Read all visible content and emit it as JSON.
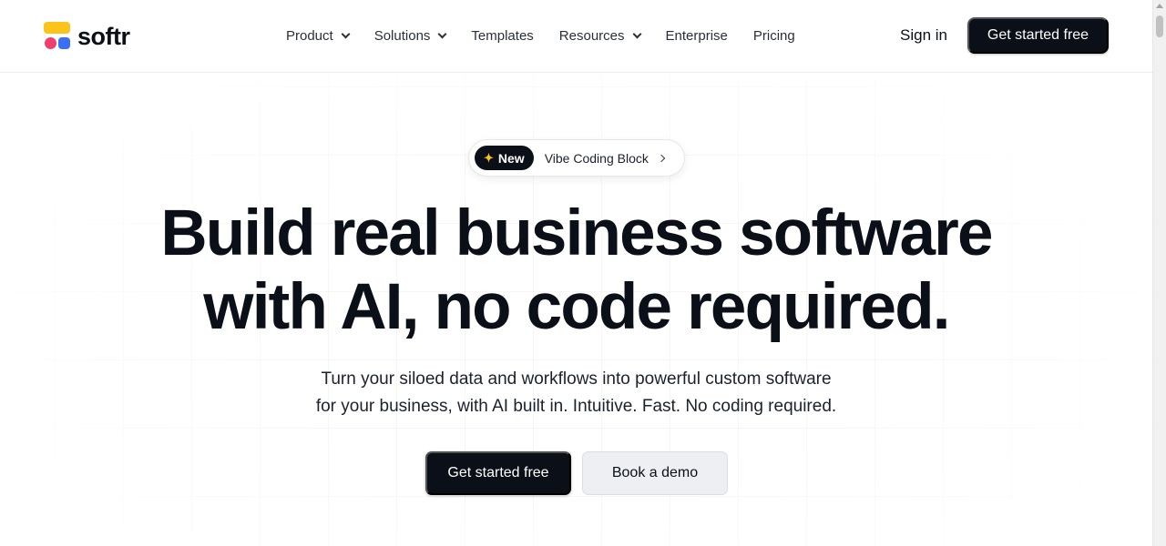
{
  "brand": {
    "name": "softr"
  },
  "nav": {
    "items": [
      {
        "label": "Product",
        "has_dropdown": true
      },
      {
        "label": "Solutions",
        "has_dropdown": true
      },
      {
        "label": "Templates",
        "has_dropdown": false
      },
      {
        "label": "Resources",
        "has_dropdown": true
      },
      {
        "label": "Enterprise",
        "has_dropdown": false
      },
      {
        "label": "Pricing",
        "has_dropdown": false
      }
    ],
    "sign_in": "Sign in",
    "cta": "Get started free"
  },
  "badge": {
    "tag": "New",
    "text": "Vibe Coding Block"
  },
  "hero": {
    "headline_line1": "Build real business software",
    "headline_line2": "with AI, no code required.",
    "subtitle_line1": "Turn your siloed data and workflows into powerful custom software",
    "subtitle_line2": "for your business, with AI built in. Intuitive. Fast. No coding required.",
    "primary_cta": "Get started free",
    "secondary_cta": "Book a demo"
  },
  "colors": {
    "dark": "#0b0f17",
    "logo_yellow": "#fcc419",
    "logo_pink": "#f03e6e",
    "logo_blue": "#3b6ff5"
  }
}
